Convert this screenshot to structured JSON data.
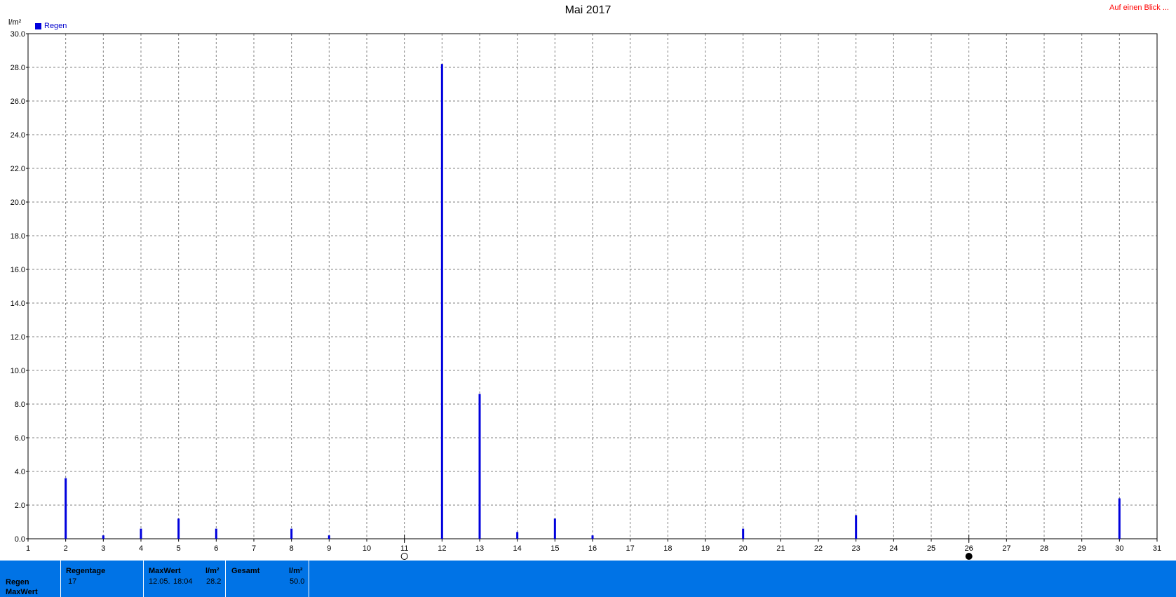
{
  "chart_data": {
    "type": "bar",
    "title": "Mai 2017",
    "ylabel": "l/m²",
    "ylim": [
      0,
      30
    ],
    "yticks": [
      "0.0",
      "2.0",
      "4.0",
      "6.0",
      "8.0",
      "10.0",
      "12.0",
      "14.0",
      "16.0",
      "18.0",
      "20.0",
      "22.0",
      "24.0",
      "26.0",
      "28.0",
      "30.0"
    ],
    "xlim": [
      1,
      31
    ],
    "xticks": [
      "1",
      "2",
      "3",
      "4",
      "5",
      "6",
      "7",
      "8",
      "9",
      "10",
      "11",
      "12",
      "13",
      "14",
      "15",
      "16",
      "17",
      "18",
      "19",
      "20",
      "21",
      "22",
      "23",
      "24",
      "25",
      "26",
      "27",
      "28",
      "29",
      "30",
      "31"
    ],
    "grid": true,
    "legend_position": "top-left",
    "series": [
      {
        "name": "Regen",
        "color": "#0000dd",
        "points": [
          {
            "x": 2,
            "y": 3.6
          },
          {
            "x": 3,
            "y": 0.2
          },
          {
            "x": 4,
            "y": 0.6
          },
          {
            "x": 5,
            "y": 1.2
          },
          {
            "x": 6,
            "y": 0.6
          },
          {
            "x": 8,
            "y": 0.6
          },
          {
            "x": 9,
            "y": 0.2
          },
          {
            "x": 12,
            "y": 28.2
          },
          {
            "x": 13,
            "y": 8.6
          },
          {
            "x": 14,
            "y": 0.4
          },
          {
            "x": 15,
            "y": 1.2
          },
          {
            "x": 16,
            "y": 0.2
          },
          {
            "x": 20,
            "y": 0.6
          },
          {
            "x": 23,
            "y": 1.4
          },
          {
            "x": 30,
            "y": 2.4
          }
        ]
      }
    ],
    "annotations": [
      {
        "x": 11,
        "symbol": "open-circle"
      },
      {
        "x": 26,
        "symbol": "filled-circle"
      }
    ]
  },
  "header": {
    "link": "Auf einen Blick ..."
  },
  "footer": {
    "row_label_1": "Regen",
    "row_label_2": "MaxWert",
    "regentage_label": "Regentage",
    "regentage_value": "17",
    "maxwert_label": "MaxWert",
    "maxwert_unit": "l/m²",
    "maxwert_date": "12.05.",
    "maxwert_time": "18:04",
    "maxwert_value": "28.2",
    "gesamt_label": "Gesamt",
    "gesamt_unit": "l/m²",
    "gesamt_value": "50.0"
  },
  "colors": {
    "bar": "#0000dd",
    "grid": "#808080",
    "footer_bg": "#0073e6",
    "link": "#ff0000"
  }
}
